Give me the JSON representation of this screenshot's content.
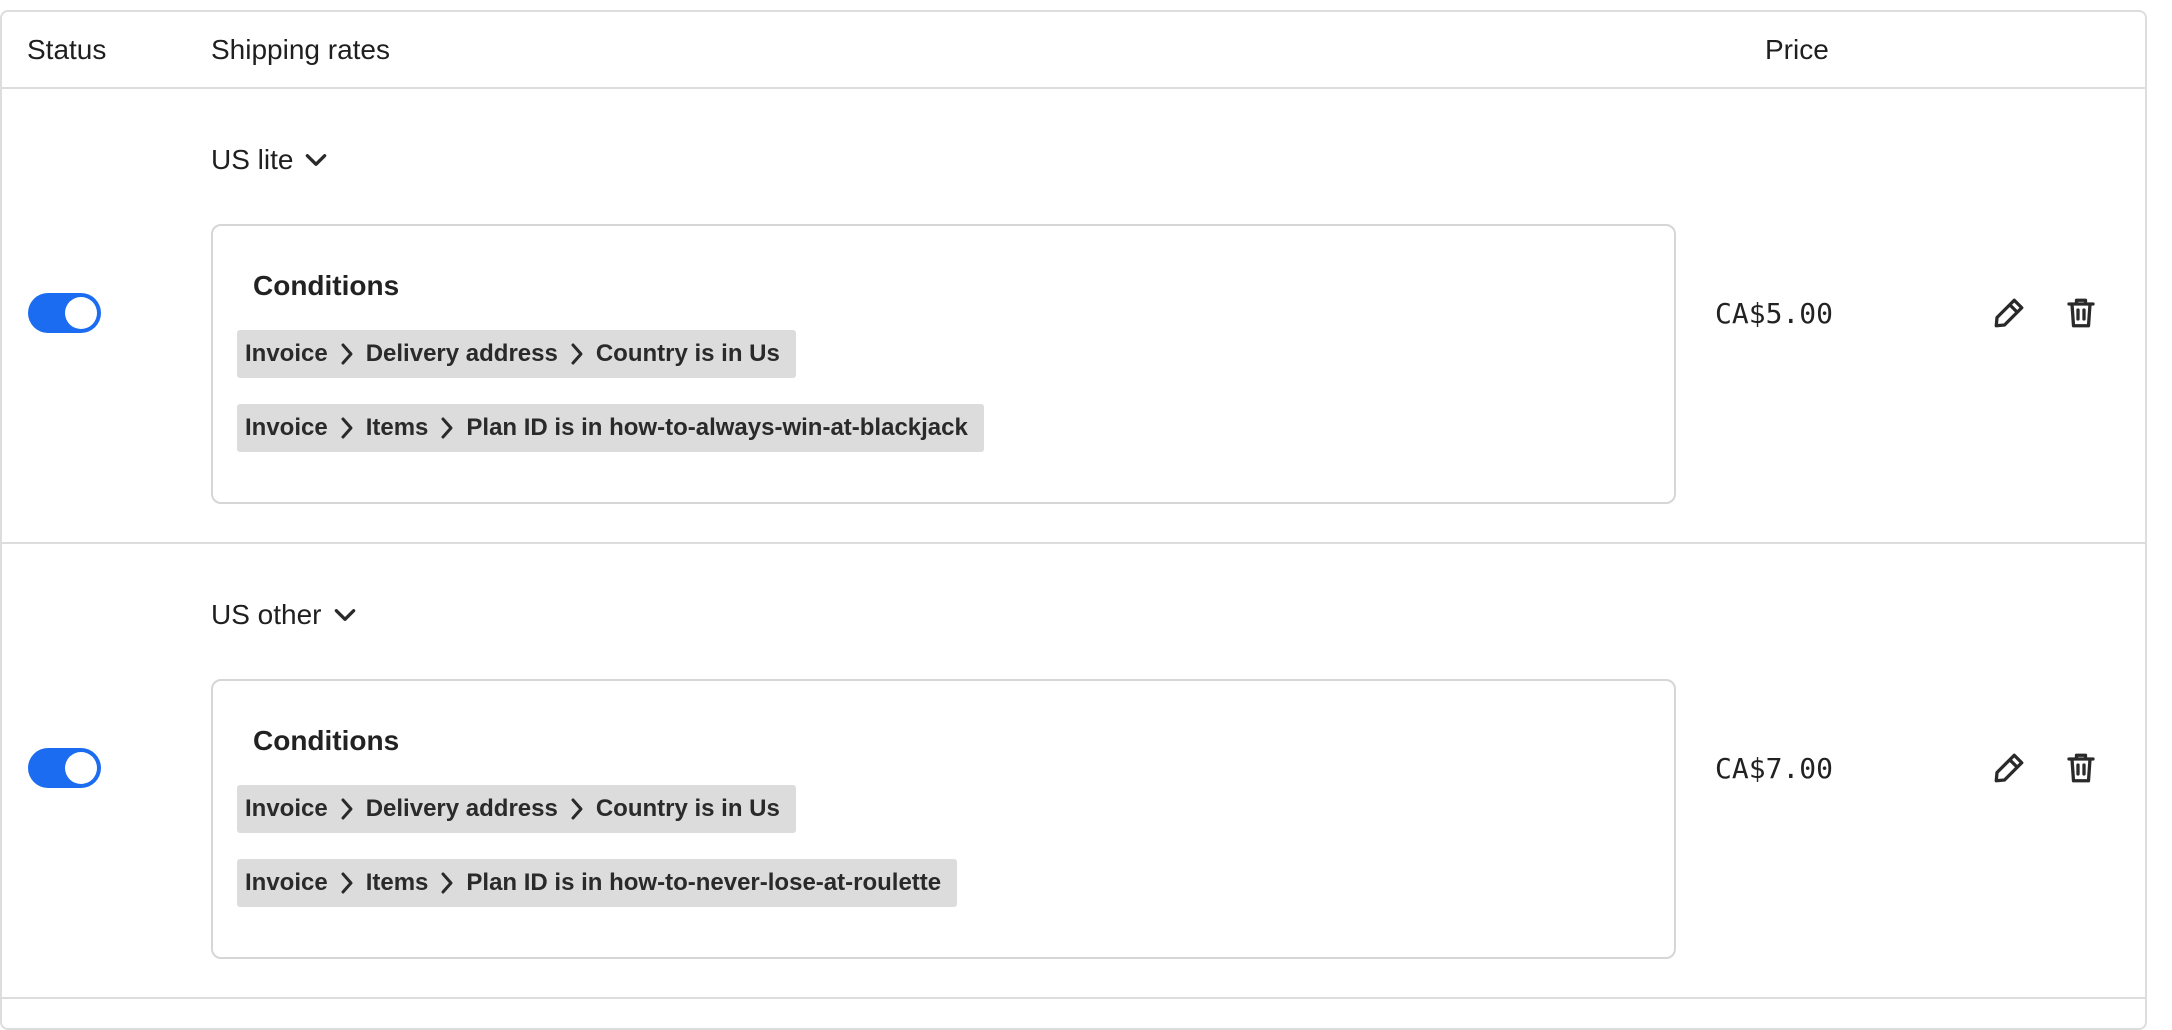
{
  "header": {
    "status": "Status",
    "shipping_rates": "Shipping rates",
    "price": "Price"
  },
  "rows": [
    {
      "name": "US lite",
      "enabled": true,
      "conditions_title": "Conditions",
      "conditions": [
        {
          "parts": [
            "Invoice",
            "Delivery address",
            "Country is in Us"
          ]
        },
        {
          "parts": [
            "Invoice",
            "Items",
            "Plan ID is in how-to-always-win-at-blackjack"
          ]
        }
      ],
      "price": "CA$5.00"
    },
    {
      "name": "US other",
      "enabled": true,
      "conditions_title": "Conditions",
      "conditions": [
        {
          "parts": [
            "Invoice",
            "Delivery address",
            "Country is in Us"
          ]
        },
        {
          "parts": [
            "Invoice",
            "Items",
            "Plan ID is in how-to-never-lose-at-roulette"
          ]
        }
      ],
      "price": "CA$7.00"
    }
  ],
  "icons": {
    "chevron": "chevron-down-icon",
    "separator": "chevron-right-icon",
    "edit": "pencil-icon",
    "delete": "trash-icon"
  },
  "colors": {
    "toggle_on": "#1b6cf0",
    "chip_bg": "#dcdcdc",
    "border": "#dddddd"
  }
}
